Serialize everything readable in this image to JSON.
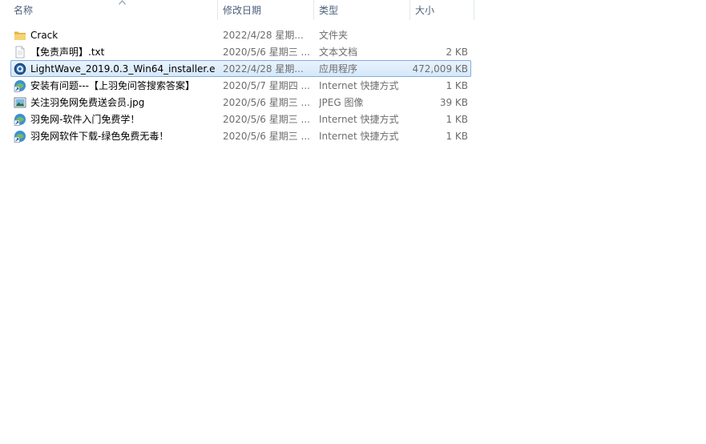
{
  "columns": {
    "name": "名称",
    "date": "修改日期",
    "type": "类型",
    "size": "大小"
  },
  "files": [
    {
      "name": "Crack",
      "date": "2022/4/28 星期...",
      "type": "文件夹",
      "size": "",
      "icon": "folder-icon"
    },
    {
      "name": "【免责声明】.txt",
      "date": "2020/5/6 星期三 ...",
      "type": "文本文档",
      "size": "2 KB",
      "icon": "text-file-icon"
    },
    {
      "name": "LightWave_2019.0.3_Win64_installer.e...",
      "date": "2022/4/28 星期...",
      "type": "应用程序",
      "size": "472,009 KB",
      "icon": "installer-app-icon"
    },
    {
      "name": "安装有问题---【上羽免问答搜索答案】",
      "date": "2020/5/7 星期四 ...",
      "type": "Internet 快捷方式",
      "size": "1 KB",
      "icon": "internet-shortcut-icon"
    },
    {
      "name": "关注羽免网免费送会员.jpg",
      "date": "2020/5/6 星期三 ...",
      "type": "JPEG 图像",
      "size": "39 KB",
      "icon": "image-file-icon"
    },
    {
      "name": "羽免网-软件入门免费学！",
      "date": "2020/5/6 星期三 ...",
      "type": "Internet 快捷方式",
      "size": "1 KB",
      "icon": "internet-shortcut-icon"
    },
    {
      "name": "羽免网软件下载-绿色免费无毒！",
      "date": "2020/5/6 星期三 ...",
      "type": "Internet 快捷方式",
      "size": "1 KB",
      "icon": "internet-shortcut-icon"
    }
  ],
  "selected_index": 2
}
